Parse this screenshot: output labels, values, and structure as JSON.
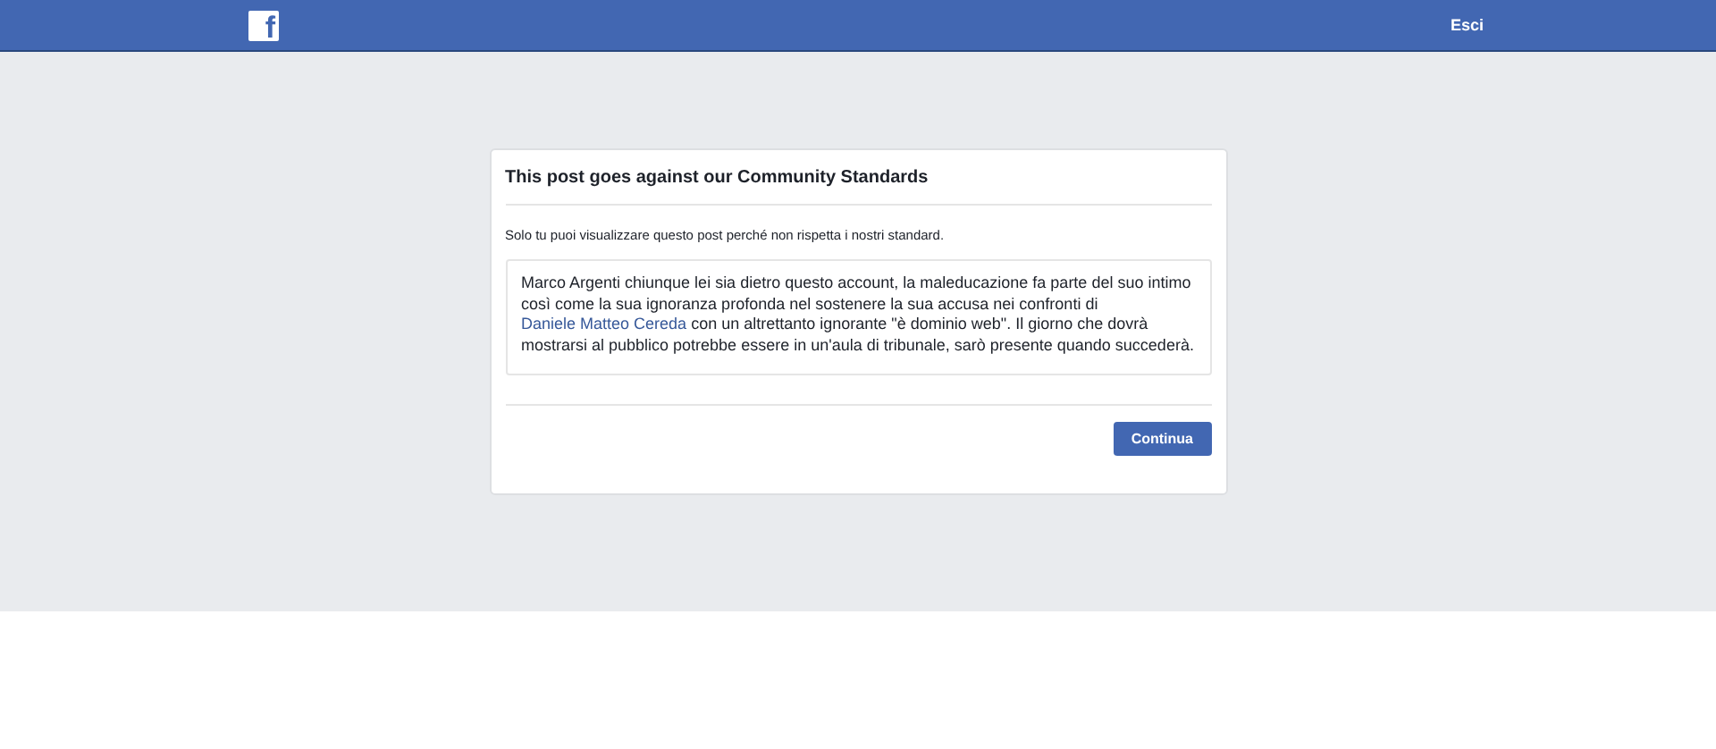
{
  "header": {
    "logo": "f",
    "logout": "Esci"
  },
  "dialog": {
    "title": "This post goes against our Community Standards",
    "notice": "Solo tu puoi visualizzare questo post perché non rispetta i nostri standard.",
    "post": {
      "before": "Marco Argenti chiunque lei sia dietro questo account, la maleducazione fa parte del suo intimo così come la sua ignoranza profonda nel sostenere la sua accusa nei confronti di ",
      "link": "Daniele Matteo Cereda",
      "after": " con un altrettanto ignorante \"è dominio web\". Il giorno che dovrà mostrarsi al pubblico potrebbe essere in un'aula di tribunale, sarò presente quando succederà."
    },
    "button": "Continua"
  }
}
